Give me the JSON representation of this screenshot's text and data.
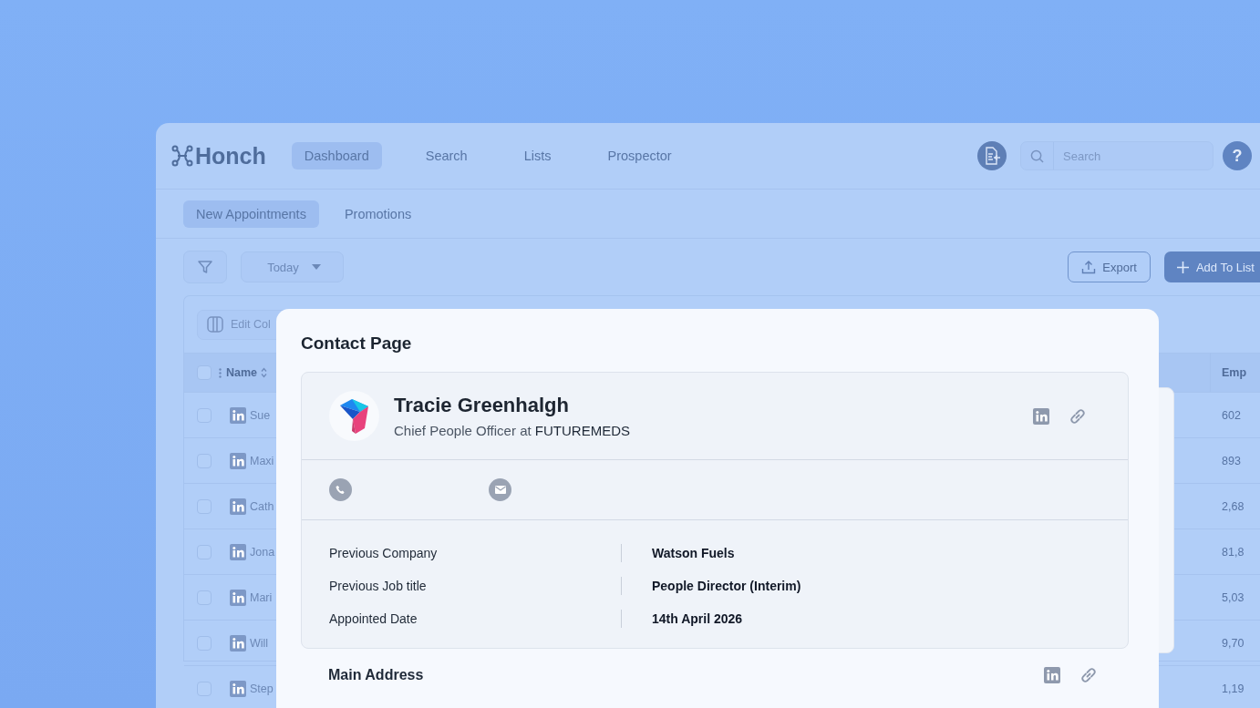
{
  "app": {
    "logo": "Honch",
    "nav": [
      {
        "label": "Dashboard",
        "selected": true
      },
      {
        "label": "Search",
        "selected": false
      },
      {
        "label": "Lists",
        "selected": false
      },
      {
        "label": "Prospector",
        "selected": false
      }
    ],
    "search": {
      "placeholder": "Search"
    },
    "help": "?",
    "tabs": [
      {
        "label": "New Appointments",
        "selected": true
      },
      {
        "label": "Promotions",
        "selected": false
      }
    ],
    "date_filter": "Today",
    "buttons": [
      {
        "kind": "export",
        "label": "Export"
      },
      {
        "kind": "add",
        "label": "Add To List"
      }
    ],
    "table": {
      "edit_columns": "Edit Col",
      "select_all": {
        "checked": false
      },
      "columns": [
        {
          "label": "Name"
        },
        {
          "label": "Emp"
        }
      ],
      "rows": [
        {
          "checked": false,
          "name": "Sue",
          "column_2": "602"
        },
        {
          "checked": false,
          "name": "Maxi",
          "column_2": "893"
        },
        {
          "checked": false,
          "name": "Cath",
          "column_2": "2,68"
        },
        {
          "checked": false,
          "name": "Jona",
          "column_2": "81,8"
        },
        {
          "checked": false,
          "name": "Mari",
          "column_2": "5,03"
        },
        {
          "checked": false,
          "name": "Will",
          "column_2": "9,70"
        },
        {
          "checked": false,
          "name": "Step",
          "column_2": "1,19"
        }
      ]
    }
  },
  "modal": {
    "title": "Contact Page",
    "contact": {
      "name": "Tracie Greenhalgh",
      "job_title": "Chief People Officer at",
      "company": "FUTUREMEDS"
    },
    "details": [
      {
        "label": "Previous Company",
        "value": "Watson Fuels"
      },
      {
        "label": "Previous Job title",
        "value": "People Director (Interim)"
      },
      {
        "label": "Appointed Date",
        "value": "14th April 2026"
      }
    ],
    "section_title": "Main Address"
  }
}
